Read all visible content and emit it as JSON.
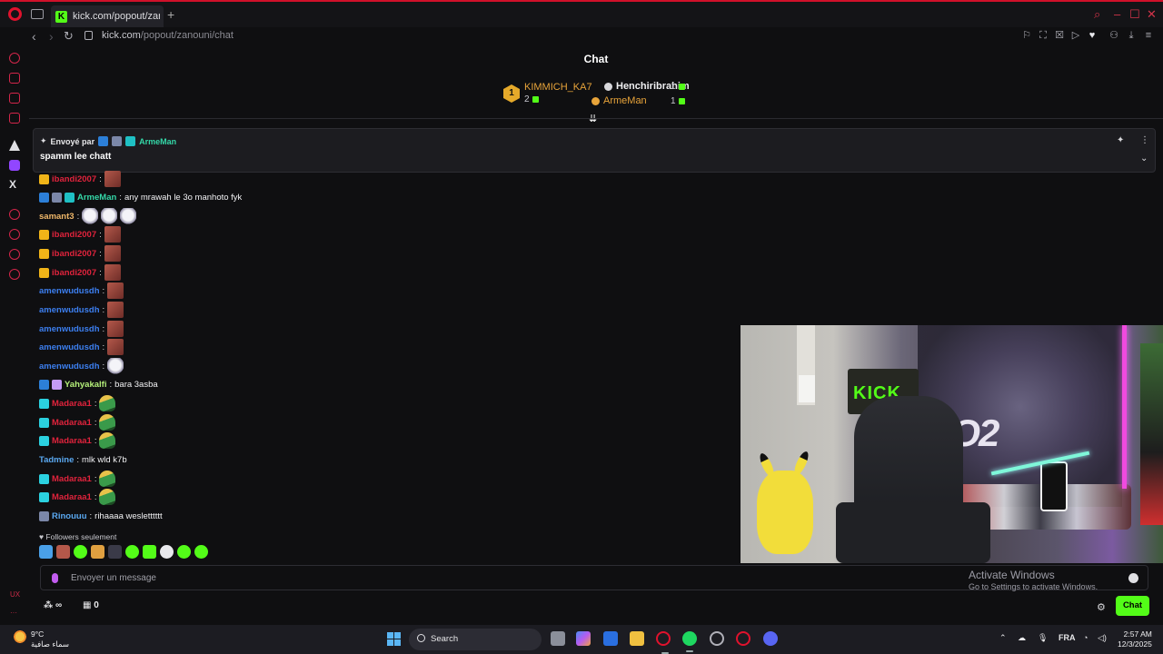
{
  "browser": {
    "tab_title": "kick.com/popout/zanouni",
    "kick_favicon": "K",
    "new_tab": "+",
    "back": "‹",
    "forward": "›",
    "reload": "↻",
    "url_host": "kick.com",
    "url_path": "/popout/zanouni/chat",
    "window_controls": {
      "search": "⌕",
      "minimize": "–",
      "maximize": "☐",
      "close": "✕"
    }
  },
  "sidebar": {
    "x_label": "X",
    "footer_a": "UX",
    "footer_b": "···"
  },
  "chat": {
    "title": "Chat",
    "leaderboard": {
      "rank1": {
        "medal": "1",
        "name": "KIMMICH_KA7",
        "count": "2"
      },
      "rank2": {
        "name": "Henchiribrahim",
        "count": "1"
      },
      "rank3": {
        "name": "ArmeMan",
        "count": "1"
      }
    },
    "pinned": {
      "sent_by_label": "Envoyé par",
      "sender": "ArmeMan",
      "message": "spamm lee chatt"
    },
    "messages": [
      {
        "user": "ibandi2007",
        "color": "red",
        "text": ""
      },
      {
        "user": "ArmeMan",
        "color": "green",
        "text": "any mrawah le 3o manhoto fyk"
      },
      {
        "user": "samant3",
        "color": "orange",
        "text": ""
      },
      {
        "user": "ibandi2007",
        "color": "red",
        "text": ""
      },
      {
        "user": "ibandi2007",
        "color": "red",
        "text": ""
      },
      {
        "user": "ibandi2007",
        "color": "red",
        "text": ""
      },
      {
        "user": "amenwudusdh",
        "color": "blue",
        "text": ""
      },
      {
        "user": "amenwudusdh",
        "color": "blue",
        "text": ""
      },
      {
        "user": "amenwudusdh",
        "color": "blue",
        "text": ""
      },
      {
        "user": "amenwudusdh",
        "color": "blue",
        "text": ""
      },
      {
        "user": "amenwudusdh",
        "color": "blue",
        "text": ""
      },
      {
        "user": "Yahyakalfi",
        "color": "lime",
        "text": "bara 3asba"
      },
      {
        "user": "Madaraa1",
        "color": "red",
        "text": ""
      },
      {
        "user": "Madaraa1",
        "color": "red",
        "text": ""
      },
      {
        "user": "Madaraa1",
        "color": "red",
        "text": ""
      },
      {
        "user": "Tadmine",
        "color": "sky",
        "text": "mlk wld k7b"
      },
      {
        "user": "Madaraa1",
        "color": "red",
        "text": ""
      },
      {
        "user": "Madaraa1",
        "color": "red",
        "text": ""
      },
      {
        "user": "Rinouuu",
        "color": "sky",
        "text": "rihaaaa wesletttttt"
      }
    ],
    "followers_only": "Followers seulement",
    "input_placeholder": "Envoyer un message",
    "bottom": {
      "infinity": "∞",
      "box_count": "0",
      "chat_button": "Chat"
    }
  },
  "watermark": {
    "line1": "Activate Windows",
    "line2": "Go to Settings to activate Windows."
  },
  "video": {
    "sign": "KICK",
    "graffiti": "2O2"
  },
  "taskbar": {
    "temperature": "9°C",
    "weather_desc": "سماء صافية",
    "search_label": "Search",
    "lang": "FRA",
    "time": "2:57 AM",
    "date": "12/3/2025"
  },
  "colors": {
    "kick_green": "#53fc18",
    "opera_red": "#e0122d",
    "user_red": "#e0233c",
    "user_blue": "#3c7ff0",
    "user_green": "#34d8a8"
  }
}
